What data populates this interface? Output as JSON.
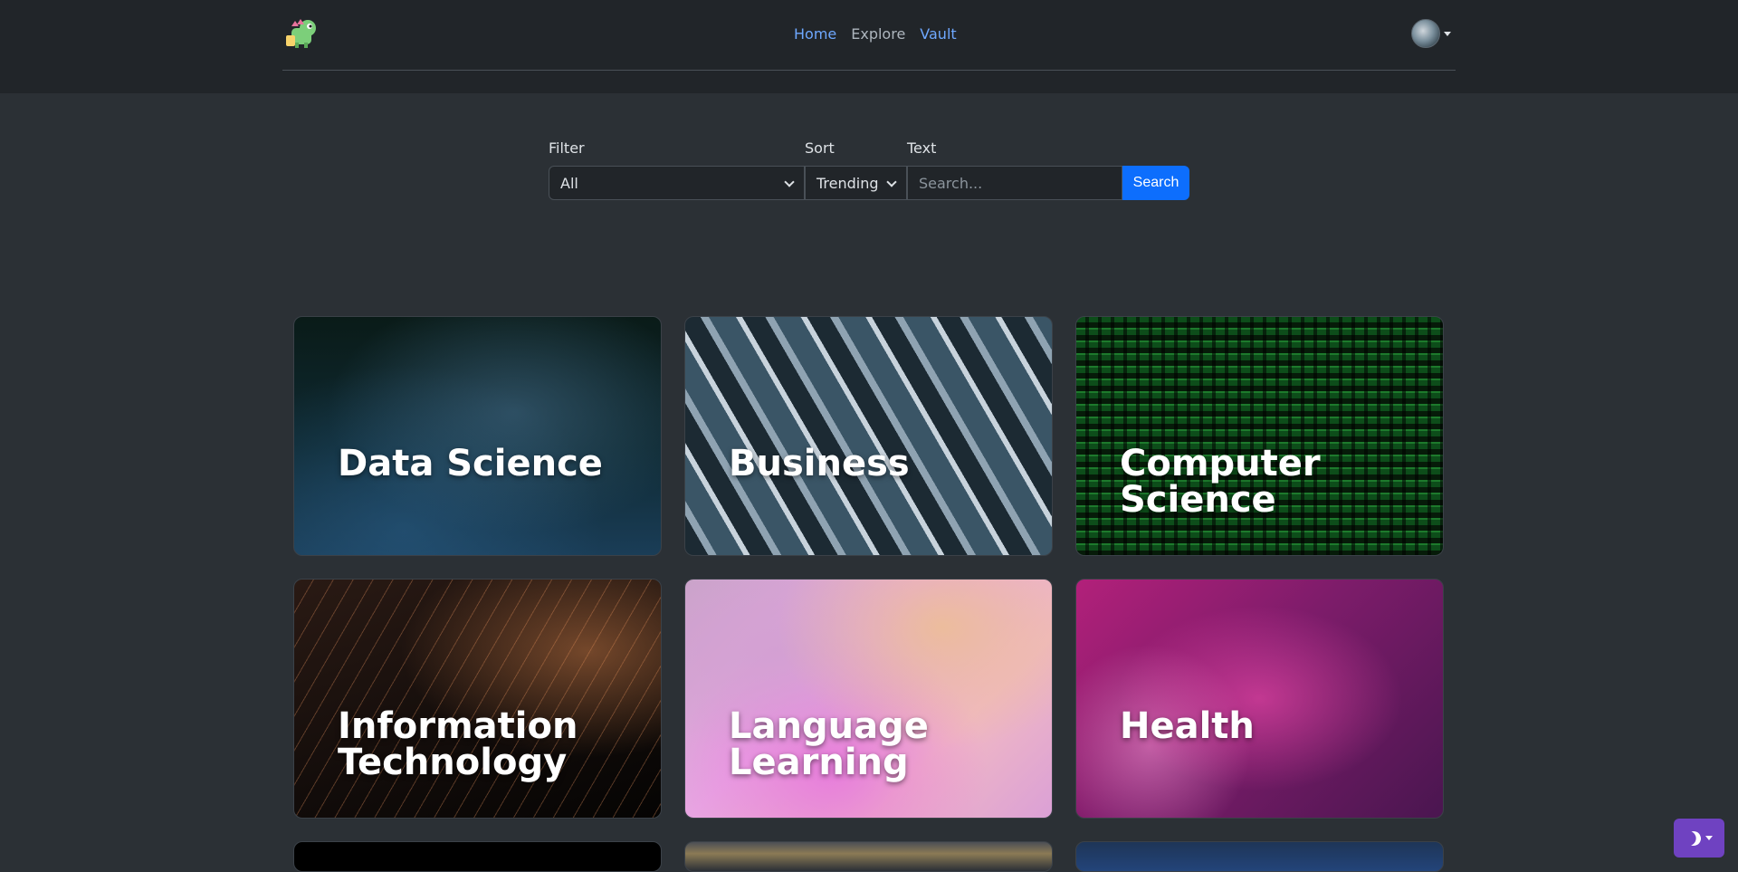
{
  "nav": {
    "links": [
      {
        "label": "Home"
      },
      {
        "label": "Explore"
      },
      {
        "label": "Vault"
      }
    ]
  },
  "search": {
    "filter_label": "Filter",
    "filter_value": "All",
    "sort_label": "Sort",
    "sort_value": "Trending",
    "text_label": "Text",
    "text_placeholder": "Search...",
    "button_label": "Search"
  },
  "categories": [
    {
      "title": "Data Science"
    },
    {
      "title": "Business"
    },
    {
      "title": "Computer Science"
    },
    {
      "title": "Information Technology"
    },
    {
      "title": "Language Learning"
    },
    {
      "title": "Health"
    }
  ],
  "colors": {
    "page_bg": "#2b3035",
    "navbar_bg": "#212529",
    "link_active": "#6ea8fe",
    "primary": "#0d6efd",
    "theme_toggle": "#6f42c1"
  },
  "icons": {
    "logo": "dragon-logo-icon",
    "avatar": "user-avatar",
    "theme": "moon-icon"
  }
}
